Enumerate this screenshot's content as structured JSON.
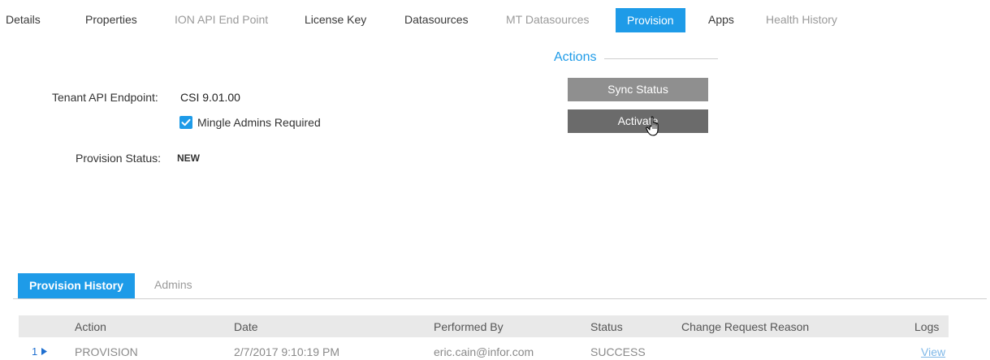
{
  "tabs": [
    {
      "label": "Details",
      "state": "normal"
    },
    {
      "label": "Properties",
      "state": "normal"
    },
    {
      "label": "ION API End Point",
      "state": "disabled"
    },
    {
      "label": "License Key",
      "state": "normal"
    },
    {
      "label": "Datasources",
      "state": "normal"
    },
    {
      "label": "MT Datasources",
      "state": "disabled"
    },
    {
      "label": "Provision",
      "state": "active"
    },
    {
      "label": "Apps",
      "state": "normal"
    },
    {
      "label": "Health History",
      "state": "disabled"
    }
  ],
  "form": {
    "tenant_api_label": "Tenant API Endpoint:",
    "tenant_api_value": "CSI 9.01.00",
    "mingle_admins_label": "Mingle Admins Required",
    "mingle_admins_checked": true,
    "provision_status_label": "Provision Status:",
    "provision_status_value": "NEW"
  },
  "actions": {
    "title": "Actions",
    "sync_label": "Sync Status",
    "activate_label": "Activate"
  },
  "subtabs": {
    "active_label": "Provision History",
    "other_label": "Admins"
  },
  "grid": {
    "headers": [
      "Action",
      "Date",
      "Performed By",
      "Status",
      "Change Request Reason",
      "Logs"
    ],
    "rows": [
      {
        "num": "1",
        "action": "PROVISION",
        "date": "2/7/2017 9:10:19 PM",
        "performed_by": "eric.cain@infor.com",
        "status": "SUCCESS",
        "reason": "",
        "logs": "View"
      }
    ]
  },
  "colors": {
    "accent": "#1e9be8",
    "button_gray": "#8f8f8f",
    "button_dark": "#6b6b6b"
  }
}
